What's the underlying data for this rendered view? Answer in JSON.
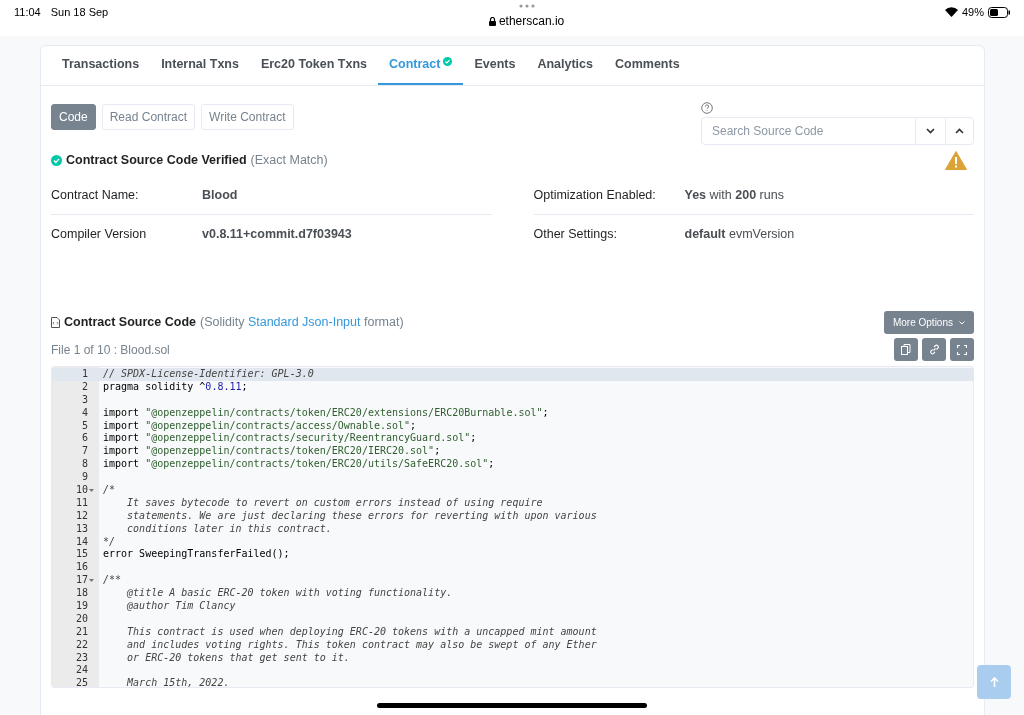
{
  "status_bar": {
    "time": "11:04",
    "date": "Sun 18 Sep",
    "url": "etherscan.io",
    "battery": "49%"
  },
  "tabs": [
    {
      "label": "Transactions",
      "selected": false,
      "verified": false
    },
    {
      "label": "Internal Txns",
      "selected": false,
      "verified": false
    },
    {
      "label": "Erc20 Token Txns",
      "selected": false,
      "verified": false
    },
    {
      "label": "Contract",
      "selected": true,
      "verified": true
    },
    {
      "label": "Events",
      "selected": false,
      "verified": false
    },
    {
      "label": "Analytics",
      "selected": false,
      "verified": false
    },
    {
      "label": "Comments",
      "selected": false,
      "verified": false
    }
  ],
  "subtabs": [
    {
      "label": "Code",
      "selected": true
    },
    {
      "label": "Read Contract",
      "selected": false
    },
    {
      "label": "Write Contract",
      "selected": false
    }
  ],
  "search": {
    "placeholder": "Search Source Code"
  },
  "verified": {
    "title": "Contract Source Code Verified",
    "note": "(Exact Match)"
  },
  "details": [
    {
      "label": "Contract Name:",
      "value": "**Blood**"
    },
    {
      "label": "Optimization Enabled:",
      "value": "**Yes** with **200** runs"
    },
    {
      "label": "Compiler Version",
      "value": "**v0.8.11+commit.d7f03943**"
    },
    {
      "label": "Other Settings:",
      "value": "**default** evmVersion"
    }
  ],
  "source": {
    "title": "Contract Source Code",
    "pre": "(Solidity",
    "link": "Standard Json-Input",
    "post": "format)",
    "file": "File 1 of 10 : Blood.sol",
    "more_options": "More Options"
  },
  "code": [
    {
      "number": "1",
      "fold": false,
      "highlighted": true,
      "segments": [
        {
          "kind": "comment",
          "text": "// SPDX-License-Identifier: GPL-3.0"
        }
      ]
    },
    {
      "number": "2",
      "fold": false,
      "highlighted": false,
      "segments": [
        {
          "kind": "plain",
          "text": "pragma solidity ^"
        },
        {
          "kind": "number",
          "text": "0.8.11"
        },
        {
          "kind": "plain",
          "text": ";"
        }
      ]
    },
    {
      "number": "3",
      "fold": false,
      "highlighted": false
    },
    {
      "number": "4",
      "fold": false,
      "highlighted": false,
      "segments": [
        {
          "kind": "plain",
          "text": "import "
        },
        {
          "kind": "string",
          "text": "\"@openzeppelin/contracts/token/ERC20/extensions/ERC20Burnable.sol\""
        },
        {
          "kind": "plain",
          "text": ";"
        }
      ]
    },
    {
      "number": "5",
      "fold": false,
      "highlighted": false,
      "segments": [
        {
          "kind": "plain",
          "text": "import "
        },
        {
          "kind": "string",
          "text": "\"@openzeppelin/contracts/access/Ownable.sol\""
        },
        {
          "kind": "plain",
          "text": ";"
        }
      ]
    },
    {
      "number": "6",
      "fold": false,
      "highlighted": false,
      "segments": [
        {
          "kind": "plain",
          "text": "import "
        },
        {
          "kind": "string",
          "text": "\"@openzeppelin/contracts/security/ReentrancyGuard.sol\""
        },
        {
          "kind": "plain",
          "text": ";"
        }
      ]
    },
    {
      "number": "7",
      "fold": false,
      "highlighted": false,
      "segments": [
        {
          "kind": "plain",
          "text": "import "
        },
        {
          "kind": "string",
          "text": "\"@openzeppelin/contracts/token/ERC20/IERC20.sol\""
        },
        {
          "kind": "plain",
          "text": ";"
        }
      ]
    },
    {
      "number": "8",
      "fold": false,
      "highlighted": false,
      "segments": [
        {
          "kind": "plain",
          "text": "import "
        },
        {
          "kind": "string",
          "text": "\"@openzeppelin/contracts/token/ERC20/utils/SafeERC20.sol\""
        },
        {
          "kind": "plain",
          "text": ";"
        }
      ]
    },
    {
      "number": "9",
      "fold": false,
      "highlighted": false
    },
    {
      "number": "10",
      "fold": true,
      "highlighted": false,
      "segments": [
        {
          "kind": "comment",
          "text": "/*"
        }
      ]
    },
    {
      "number": "11",
      "fold": false,
      "highlighted": false,
      "segments": [
        {
          "kind": "comment",
          "text": "    It saves bytecode to revert on custom errors instead of using require"
        }
      ]
    },
    {
      "number": "12",
      "fold": false,
      "highlighted": false,
      "segments": [
        {
          "kind": "comment",
          "text": "    statements. We are just declaring these errors for reverting with upon various"
        }
      ]
    },
    {
      "number": "13",
      "fold": false,
      "highlighted": false,
      "segments": [
        {
          "kind": "comment",
          "text": "    conditions later in this contract."
        }
      ]
    },
    {
      "number": "14",
      "fold": false,
      "highlighted": false,
      "segments": [
        {
          "kind": "comment",
          "text": "*/"
        }
      ]
    },
    {
      "number": "15",
      "fold": false,
      "highlighted": false,
      "segments": [
        {
          "kind": "plain",
          "text": "error SweepingTransferFailed();"
        }
      ]
    },
    {
      "number": "16",
      "fold": false,
      "highlighted": false
    },
    {
      "number": "17",
      "fold": true,
      "highlighted": false,
      "segments": [
        {
          "kind": "comment",
          "text": "/**"
        }
      ]
    },
    {
      "number": "18",
      "fold": false,
      "highlighted": false,
      "segments": [
        {
          "kind": "comment",
          "text": "    @title A basic ERC-20 token with voting functionality."
        }
      ]
    },
    {
      "number": "19",
      "fold": false,
      "highlighted": false,
      "segments": [
        {
          "kind": "comment",
          "text": "    @author Tim Clancy"
        }
      ]
    },
    {
      "number": "20",
      "fold": false,
      "highlighted": false
    },
    {
      "number": "21",
      "fold": false,
      "highlighted": false,
      "segments": [
        {
          "kind": "comment",
          "text": "    This contract is used when deploying ERC-20 tokens with a uncapped mint amount"
        }
      ]
    },
    {
      "number": "22",
      "fold": false,
      "highlighted": false,
      "segments": [
        {
          "kind": "comment",
          "text": "    and includes voting rights. This token contract may also be swept of any Ether"
        }
      ]
    },
    {
      "number": "23",
      "fold": false,
      "highlighted": false,
      "segments": [
        {
          "kind": "comment",
          "text": "    or ERC-20 tokens that get sent to it."
        }
      ]
    },
    {
      "number": "24",
      "fold": false,
      "highlighted": false
    },
    {
      "number": "25",
      "fold": false,
      "highlighted": false,
      "segments": [
        {
          "kind": "comment",
          "text": "    March 15th, 2022."
        }
      ]
    }
  ]
}
